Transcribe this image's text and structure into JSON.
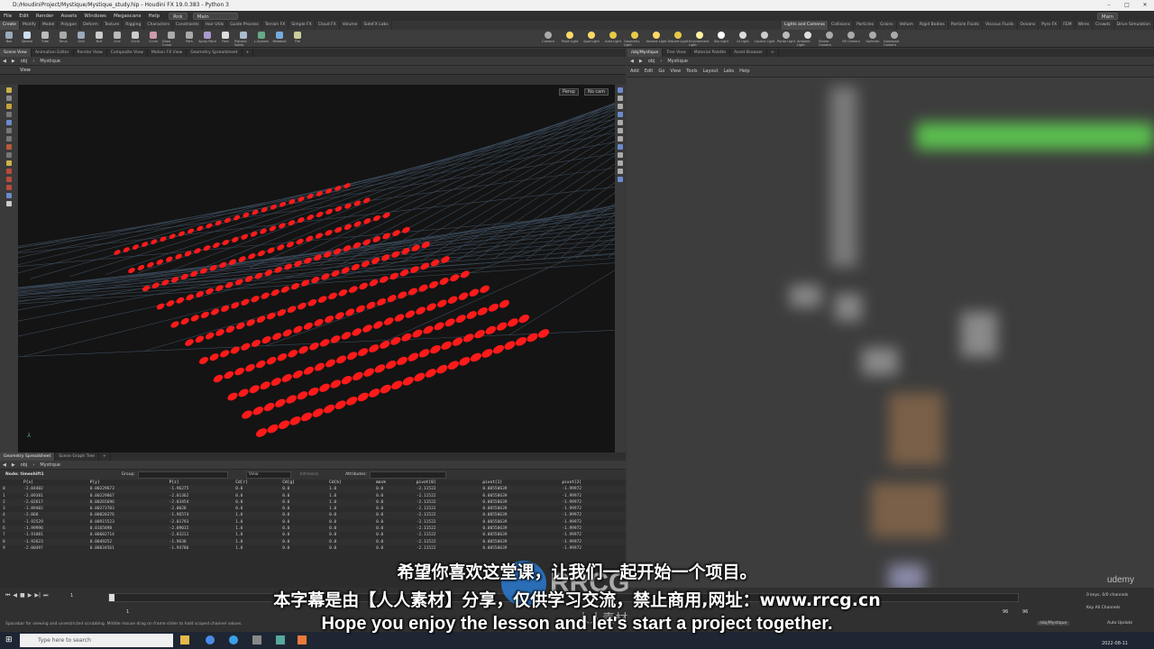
{
  "window": {
    "title": "D:/HoudiniProject/Mystique/Mystique_study.hip - Houdini FX 19.0.383 - Python 3"
  },
  "menu": {
    "items": [
      "File",
      "Edit",
      "Render",
      "Assets",
      "Windows",
      "Megascans",
      "Help"
    ],
    "build_label": "Rnk",
    "desktop_label": "Main",
    "right_desktop": "Main"
  },
  "shelf": {
    "left_tabs": [
      "Create",
      "Modify",
      "Model",
      "Polygon",
      "Deform",
      "Texture",
      "Rigging",
      "Characters",
      "Constraints",
      "Hair Utils",
      "Guide Process",
      "Terrain FX",
      "Simple FX",
      "Cloud FX",
      "Volume",
      "SideFX Labs"
    ],
    "right_tabs": [
      "Lights and Cameras",
      "Collisions",
      "Particles",
      "Grains",
      "Vellum",
      "Rigid Bodies",
      "Particle Fluids",
      "Viscous Fluids",
      "Oceans",
      "Pyro FX",
      "FEM",
      "Wires",
      "Crowds",
      "Drive Simulation"
    ],
    "left_tools": [
      "Box",
      "Sphere",
      "Tube",
      "Torus",
      "Grid",
      "Null",
      "Line",
      "Circle",
      "Curve",
      "Draw Curve",
      "Path",
      "Spray Paint",
      "Font",
      "Platonic Solids",
      "L-System",
      "Metaball",
      "File"
    ],
    "right_tools": [
      "Camera",
      "Point Light",
      "Spot Light",
      "Area Light",
      "Geometry Light",
      "Volume Light",
      "Distant Light",
      "Environment Light",
      "Sky Light",
      "GI Light",
      "Caustic Light",
      "Portal Light",
      "Ambient Light",
      "Stereo Camera",
      "VR Camera",
      "Switcher",
      "Gamepad Camera"
    ]
  },
  "left_pane": {
    "tabs": [
      "Scene View",
      "Animation Editor",
      "Render View",
      "Composite View",
      "Motion FX View",
      "Geometry Spreadsheet"
    ],
    "path": [
      "obj",
      "Mystique"
    ],
    "view_label": "View",
    "persp_label": "Persp",
    "cam_label": "No cam"
  },
  "spreadsheet": {
    "tabs": [
      "Geometry Spreadsheet",
      "Scene Graph Tree"
    ],
    "path": [
      "obj",
      "Mystique"
    ],
    "node_label": "Node: timeshift1",
    "group_label": "Group:",
    "view_label": "View",
    "intrinsics_label": "Intrinsics",
    "attributes_label": "Attributes:",
    "columns": [
      "",
      "P[x]",
      "P[y]",
      "P[z]",
      "Cd[r]",
      "Cd[g]",
      "Cd[b]",
      "mask",
      "pivot[0]",
      "pivot[1]",
      "pivot[2]"
    ],
    "rows": [
      [
        "0",
        "-2.04402",
        "0.00229673",
        "-1.96275",
        "0.0",
        "0.0",
        "1.0",
        "0.0",
        "-2.11522",
        "0.00550639",
        "-1.99972"
      ],
      [
        "1",
        "-2.09381",
        "0.00229867",
        "-2.01362",
        "0.0",
        "0.0",
        "1.0",
        "0.0",
        "-2.11522",
        "0.00550639",
        "-1.99972"
      ],
      [
        "2",
        "-2.02617",
        "0.00265696",
        "-2.03454",
        "0.0",
        "0.0",
        "1.0",
        "0.0",
        "-2.11522",
        "0.00550639",
        "-1.99972"
      ],
      [
        "3",
        "-1.89402",
        "0.00273703",
        "-2.0028",
        "0.0",
        "0.0",
        "1.0",
        "0.0",
        "-2.11522",
        "0.00550639",
        "-1.99972"
      ],
      [
        "4",
        "-2.068",
        "0.00820376",
        "-1.96574",
        "1.0",
        "0.0",
        "0.0",
        "0.0",
        "-2.11522",
        "0.00550639",
        "-1.99972"
      ],
      [
        "5",
        "-1.92529",
        "0.00915523",
        "-2.01793",
        "1.0",
        "0.0",
        "0.0",
        "0.0",
        "-2.11522",
        "0.00550639",
        "-1.99972"
      ],
      [
        "6",
        "-1.99996",
        "0.0165898",
        "-2.09015",
        "1.0",
        "0.0",
        "0.0",
        "0.0",
        "-2.11522",
        "0.00550639",
        "-1.99972"
      ],
      [
        "7",
        "-1.91881",
        "0.00602714",
        "-2.03211",
        "1.0",
        "0.0",
        "0.0",
        "0.0",
        "-2.11522",
        "0.00550639",
        "-1.99972"
      ],
      [
        "8",
        "-1.92623",
        "0.0049252",
        "-1.9636",
        "1.0",
        "0.0",
        "0.0",
        "0.0",
        "-2.11522",
        "0.00550639",
        "-1.99972"
      ],
      [
        "9",
        "-2.00497",
        "0.00634561",
        "-1.94786",
        "1.0",
        "0.0",
        "0.0",
        "0.0",
        "-2.11522",
        "0.00550639",
        "-1.99972"
      ]
    ]
  },
  "right_pane": {
    "tabs": [
      "/obj/Mystique",
      "Tree View",
      "Material Palette",
      "Asset Browser"
    ],
    "path": [
      "obj",
      "Mystique"
    ],
    "menu": [
      "Add",
      "Edit",
      "Go",
      "View",
      "Tools",
      "Layout",
      "Labs",
      "Help"
    ]
  },
  "timeline": {
    "current_frame": "1",
    "start_frame": "1",
    "end_frame": "96",
    "end_frame2": "96",
    "keys_label": "0 keys, 0/0 channels",
    "key_all_label": "Key All Channels",
    "auto_update": "Auto Update",
    "status": "Spacebar for viewing and unrestricted scrubbing. Middle mouse drag on frame slider to hold scoped channel values.",
    "path_label": "/obj/Mystique"
  },
  "taskbar": {
    "search_placeholder": "Type here to search",
    "date": "2022-08-11"
  },
  "subtitles": {
    "line1": "希望你喜欢这堂课，让我们一起开始一个项目。",
    "line2": "本字幕是由【人人素材】分享，仅供学习交流，禁止商用,网址：www.rrcg.cn",
    "line3": "Hope you enjoy the lesson and let's start a project together."
  },
  "watermark": {
    "logo_text": "RRCG",
    "sub_text": "人人素材",
    "udemy": "udemy"
  },
  "colors": {
    "point_red": "#ff1a1a",
    "grid_blue": "#3a4a5a",
    "node_green": "#5bbf4f"
  }
}
